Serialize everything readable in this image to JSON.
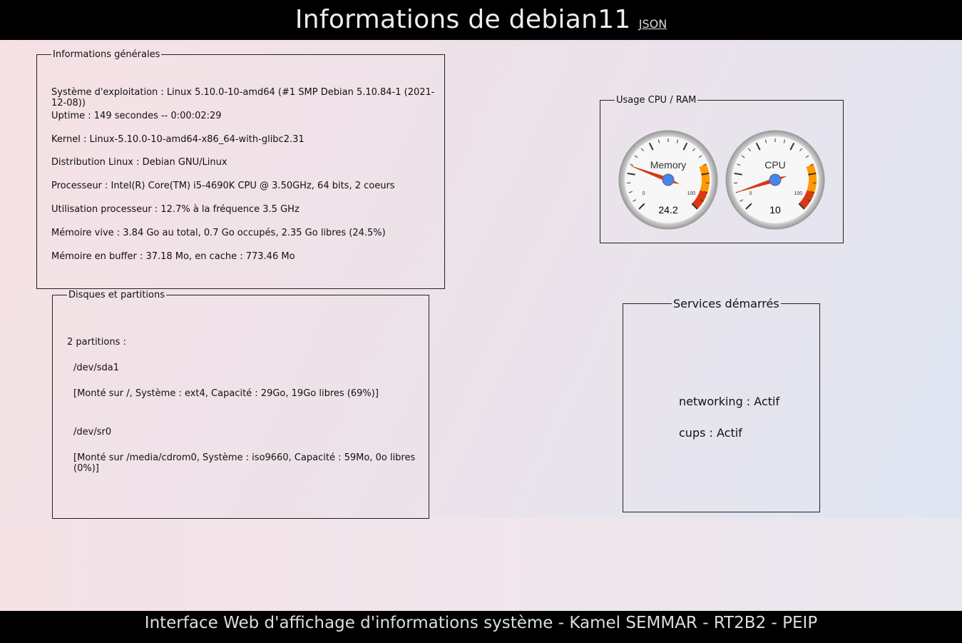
{
  "header": {
    "title": "Informations de debian11",
    "json_link": "JSON"
  },
  "general": {
    "legend": "Informations générales",
    "lines": [
      "Système d'exploitation : Linux 5.10.0-10-amd64 (#1 SMP Debian 5.10.84-1 (2021-12-08))",
      "Uptime : 149 secondes  --  0:00:02:29",
      "Kernel : Linux-5.10.0-10-amd64-x86_64-with-glibc2.31",
      "Distribution Linux : Debian GNU/Linux",
      "Processeur : Intel(R) Core(TM) i5-4690K CPU @ 3.50GHz, 64 bits, 2 coeurs",
      "Utilisation processeur : 12.7% à la fréquence 3.5 GHz",
      "Mémoire vive : 3.84 Go au total, 0.7 Go occupés, 2.35 Go libres (24.5%)",
      "Mémoire en buffer : 37.18 Mo, en cache : 773.46 Mo"
    ]
  },
  "disks": {
    "legend": "Disques et partitions",
    "count": "2 partitions :",
    "partitions": [
      {
        "device": "/dev/sda1",
        "details": "[Monté sur /, Système : ext4, Capacité : 29Go, 19Go libres (69%)]"
      },
      {
        "device": "/dev/sr0",
        "details": "[Monté sur /media/cdrom0, Système : iso9660, Capacité : 59Mo, 0o libres (0%)]"
      }
    ]
  },
  "usage": {
    "legend": "Usage CPU / RAM",
    "gauges": [
      {
        "label": "Memory",
        "value": "24.2",
        "min": "0",
        "max": "100"
      },
      {
        "label": "CPU",
        "value": "10",
        "min": "0",
        "max": "100"
      }
    ],
    "colors": {
      "yellow": "#ff9900",
      "red": "#dc3912",
      "needle": "#dc3912",
      "hub": "#4684ee"
    }
  },
  "services": {
    "legend": "Services démarrés",
    "items": [
      "networking : Actif",
      "cups : Actif"
    ]
  },
  "footer": {
    "text": "Interface Web d'affichage d'informations système - Kamel SEMMAR - RT2B2 - PEIP"
  }
}
